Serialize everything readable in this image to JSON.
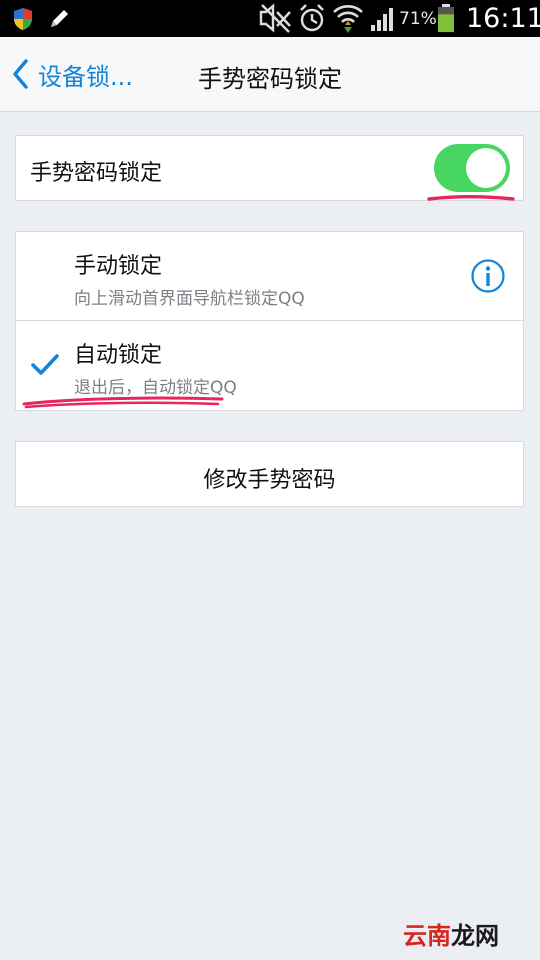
{
  "status_bar": {
    "battery_percent": "71%",
    "battery_level": 0.71,
    "time": "16:11",
    "icons": [
      "shield-icon",
      "pen-icon",
      "mute-icon",
      "alarm-icon",
      "wifi-icon",
      "signal-icon",
      "battery-icon"
    ]
  },
  "nav": {
    "back_label": "设备锁...",
    "title": "手势密码锁定"
  },
  "gesture_lock": {
    "label": "手势密码锁定",
    "enabled": true
  },
  "lock_modes": [
    {
      "title": "手动锁定",
      "subtitle": "向上滑动首界面导航栏锁定QQ",
      "selected": false
    },
    {
      "title": "自动锁定",
      "subtitle": "退出后，自动锁定QQ",
      "selected": true
    }
  ],
  "modify_button": {
    "label": "修改手势密码"
  },
  "watermark": {
    "brand_a": "云南",
    "brand_b": "龙网"
  },
  "colors": {
    "accent": "#1384d6",
    "toggle_on": "#48d662",
    "annotation": "#e8265e",
    "background": "#ebeef3"
  }
}
